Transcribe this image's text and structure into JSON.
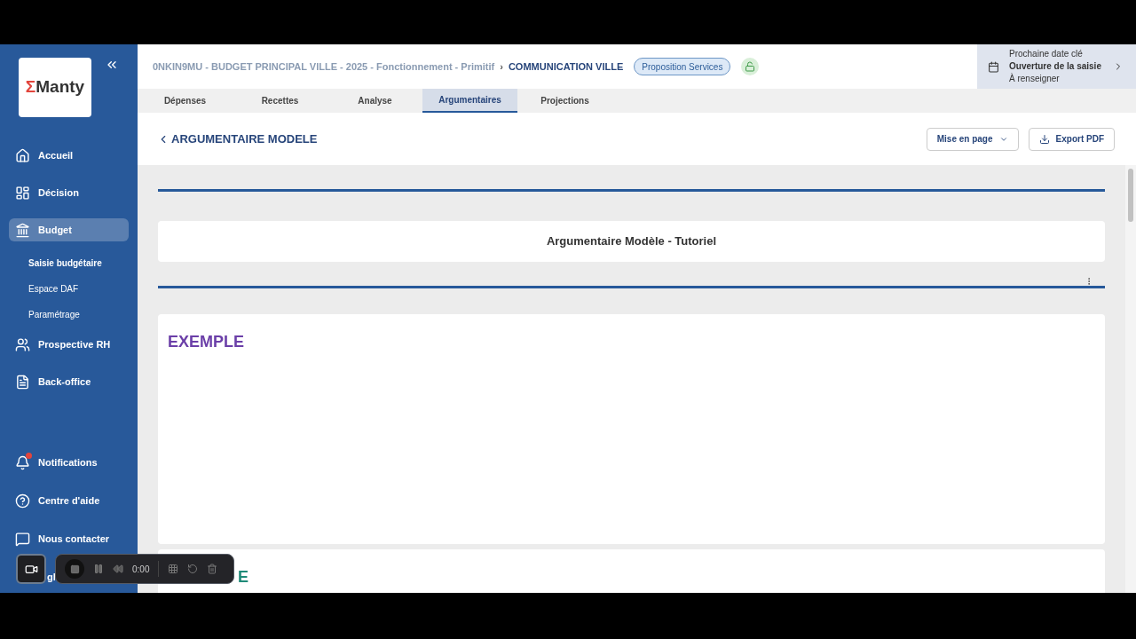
{
  "sidebar": {
    "logo_mark": "Σ",
    "logo": "Manty",
    "items": [
      {
        "kind": "home",
        "label": "Accueil",
        "selected": false
      },
      {
        "kind": "dashboard",
        "label": "Décision",
        "selected": false
      },
      {
        "kind": "bank",
        "label": "Budget",
        "selected": true,
        "children": [
          {
            "label": "Saisie budgétaire",
            "selected": true
          },
          {
            "label": "Espace DAF",
            "selected": false
          },
          {
            "label": "Paramétrage",
            "selected": false
          }
        ]
      },
      {
        "kind": "people",
        "label": "Prospective RH",
        "selected": false
      },
      {
        "kind": "file",
        "label": "Back-office",
        "selected": false
      }
    ],
    "bottom_items": [
      {
        "kind": "bell",
        "label": "Notifications",
        "badge": true
      },
      {
        "kind": "help",
        "label": "Centre d'aide",
        "badge": false
      },
      {
        "kind": "chat",
        "label": "Nous contacter",
        "badge": false
      },
      {
        "kind": "covered",
        "label": "gl"
      }
    ]
  },
  "header": {
    "breadcrumb": "0NKIN9MU - BUDGET PRINCIPAL VILLE - 2025 - Fonctionnement - Primitif",
    "separator": "›",
    "current": "COMMUNICATION VILLE",
    "status": "Proposition Services",
    "locked": false,
    "key_date": {
      "title": "Prochaine date clé",
      "event": "Ouverture de la saisie",
      "value": "À renseigner"
    }
  },
  "tabs": [
    {
      "label": "Dépenses",
      "selected": false
    },
    {
      "label": "Recettes",
      "selected": false
    },
    {
      "label": "Analyse",
      "selected": false
    },
    {
      "label": "Argumentaires",
      "selected": true
    },
    {
      "label": "Projections",
      "selected": false
    }
  ],
  "page": {
    "title": "ARGUMENTAIRE MODELE",
    "buttons": [
      {
        "kind": "dropdown",
        "label": "Mise en page"
      },
      {
        "kind": "download",
        "label": "Export PDF"
      }
    ]
  },
  "sections": [
    {
      "kind": "title",
      "text": "Argumentaire Modèle - Tutoriel"
    },
    {
      "kind": "heading",
      "text": "EXEMPLE",
      "color": "#6b3fa8"
    },
    {
      "kind": "heading",
      "text": "E",
      "color": "#1f8a78"
    }
  ],
  "recorder": {
    "time": "0:00"
  }
}
